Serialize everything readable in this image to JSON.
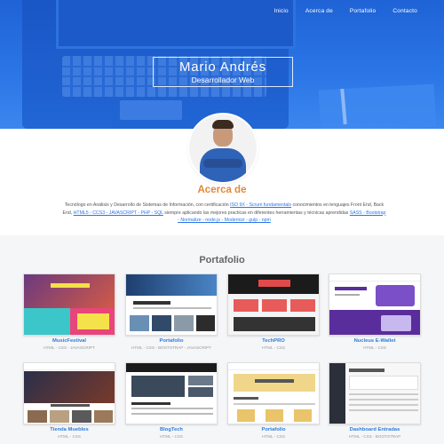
{
  "nav": {
    "items": [
      {
        "label": "Inicio"
      },
      {
        "label": "Acerca de"
      },
      {
        "label": "Portafolio"
      },
      {
        "label": "Contacto"
      }
    ]
  },
  "hero": {
    "name": "Mario Andrés",
    "role": "Desarrollador Web"
  },
  "about": {
    "title": "Acerca de",
    "text_1": "Tecnólogo en Análisis y Desarrollo de Sistemas de Información, con certificación ",
    "link_1": "ISO 9X - Scrum fundamentals",
    "text_2": " conocimientos en lenguajes Front End, Back End, ",
    "link_2": "HTML5 - CCS3 - JAVASCRIPT - PHP - SQL",
    "text_3": " siempre aplicando las mejores practicas en diferentes herramientas y técnicas aprendidas ",
    "link_3": "SASS - Bootstrap - Normalize - node.js - Modernizr - gulp - npm"
  },
  "portfolio": {
    "title": "Portafolio",
    "projects": [
      {
        "title": "MusicFestival",
        "stack": "HTML - CSS - JAVASCRIPT"
      },
      {
        "title": "Portafolio",
        "stack": "HTML - CSS - BOOTSTRAP - JAVASCRIPT"
      },
      {
        "title": "TechPRO",
        "stack": "HTML - CSS"
      },
      {
        "title": "Nucleus E-Wallet",
        "stack": "HTML - CSS"
      },
      {
        "title": "Tienda Muebles",
        "stack": "HTML - CSS"
      },
      {
        "title": "BlogTech",
        "stack": "HTML - CSS"
      },
      {
        "title": "Portafolio",
        "stack": "HTML - CSS"
      },
      {
        "title": "Dashboard Entradas",
        "stack": "HTML - CSS - BOOTSTRAP"
      }
    ]
  },
  "colors": {
    "hero_blue": "#2a75e6",
    "accent_orange": "#e08a3a",
    "link_blue": "#2f7bd8"
  }
}
